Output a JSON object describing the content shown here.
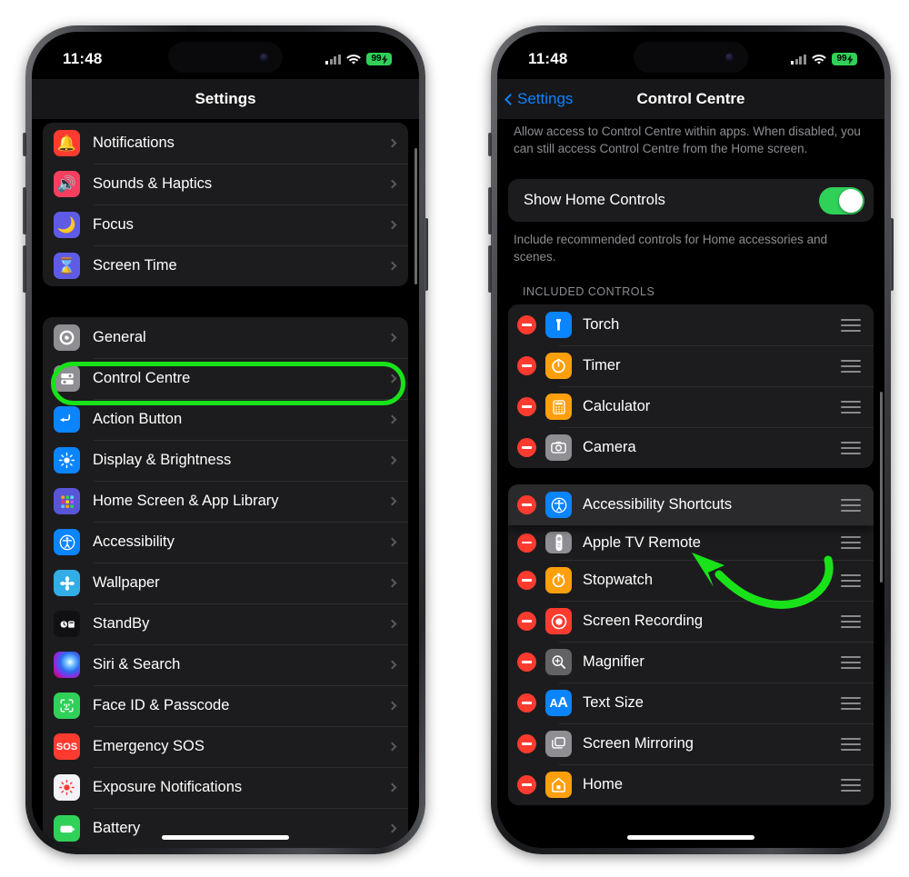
{
  "status_bar": {
    "time": "11:48",
    "battery": "99",
    "battery_charging_icon": "bolt-icon",
    "wifi_icon": "wifi-icon",
    "cellular_icon": "cellular-signal-icon"
  },
  "left_phone": {
    "nav": {
      "title": "Settings"
    },
    "groups": [
      {
        "name": "notifications-group",
        "rows": [
          {
            "label": "Notifications",
            "icon": "bell-icon",
            "color": "#ff3b30"
          },
          {
            "label": "Sounds & Haptics",
            "icon": "speaker-icon",
            "color": "#f43f5e"
          },
          {
            "label": "Focus",
            "icon": "moon-icon",
            "color": "#5e5ce6"
          },
          {
            "label": "Screen Time",
            "icon": "hourglass-icon",
            "color": "#5e5ce6"
          }
        ]
      },
      {
        "name": "general-group",
        "rows": [
          {
            "label": "General",
            "icon": "gear-icon",
            "color": "#8e8e93"
          },
          {
            "label": "Control Centre",
            "icon": "sliders-icon",
            "color": "#8e8e93",
            "highlighted": true
          },
          {
            "label": "Action Button",
            "icon": "action-button-icon",
            "color": "#0a84ff"
          },
          {
            "label": "Display & Brightness",
            "icon": "brightness-icon",
            "color": "#0a84ff"
          },
          {
            "label": "Home Screen & App Library",
            "icon": "app-grid-icon",
            "color": "#5856d6"
          },
          {
            "label": "Accessibility",
            "icon": "accessibility-icon",
            "color": "#0a84ff"
          },
          {
            "label": "Wallpaper",
            "icon": "wallpaper-icon",
            "color": "#32ade6"
          },
          {
            "label": "StandBy",
            "icon": "standby-icon",
            "color": "#111113"
          },
          {
            "label": "Siri & Search",
            "icon": "siri-icon",
            "color": "#3a2a6a"
          },
          {
            "label": "Face ID & Passcode",
            "icon": "face-id-icon",
            "color": "#30d158"
          },
          {
            "label": "Emergency SOS",
            "icon": "sos-icon",
            "color": "#ff3b30"
          },
          {
            "label": "Exposure Notifications",
            "icon": "exposure-icon",
            "color": "#f2f2f7"
          },
          {
            "label": "Battery",
            "icon": "battery-icon",
            "color": "#30d158"
          }
        ]
      }
    ],
    "highlight_annotation": {
      "shape": "oval",
      "color": "#19e219",
      "target": "Control Centre"
    }
  },
  "right_phone": {
    "nav": {
      "back_label": "Settings",
      "title": "Control Centre",
      "back_icon": "chevron-left-icon"
    },
    "top_footnote": "Allow access to Control Centre within apps. When disabled, you can still access Control Centre from the Home screen.",
    "home_controls": {
      "label": "Show Home Controls",
      "enabled": true,
      "toggle_color": "#30d158"
    },
    "home_controls_footnote": "Include recommended controls for Home accessories and scenes.",
    "section_header": "INCLUDED CONTROLS",
    "included_group_a": [
      {
        "label": "Torch",
        "icon": "torch-icon",
        "color": "#0a84ff"
      },
      {
        "label": "Timer",
        "icon": "timer-icon",
        "color": "#ff9f0a"
      },
      {
        "label": "Calculator",
        "icon": "calculator-icon",
        "color": "#ff9f0a"
      },
      {
        "label": "Camera",
        "icon": "camera-icon",
        "color": "#8e8e93"
      }
    ],
    "included_group_b": [
      {
        "label": "Accessibility Shortcuts",
        "icon": "accessibility-icon",
        "color": "#0a84ff",
        "dragging": true
      },
      {
        "label": "Apple TV Remote",
        "icon": "tv-remote-icon",
        "color": "#8e8e93"
      },
      {
        "label": "Stopwatch",
        "icon": "stopwatch-icon",
        "color": "#ff9f0a"
      },
      {
        "label": "Screen Recording",
        "icon": "record-icon",
        "color": "#ff3b30"
      },
      {
        "label": "Magnifier",
        "icon": "magnifier-icon",
        "color": "#636366"
      },
      {
        "label": "Text Size",
        "icon": "text-size-icon",
        "color": "#0a84ff"
      },
      {
        "label": "Screen Mirroring",
        "icon": "screen-mirror-icon",
        "color": "#8e8e93"
      },
      {
        "label": "Home",
        "icon": "home-icon",
        "color": "#ff9f0a"
      }
    ],
    "remove_icon": "remove-minus-icon",
    "reorder_icon": "reorder-grip-icon",
    "arrow_annotation": {
      "shape": "curved-arrow",
      "color": "#19e219",
      "points_to": "Accessibility Shortcuts"
    }
  }
}
